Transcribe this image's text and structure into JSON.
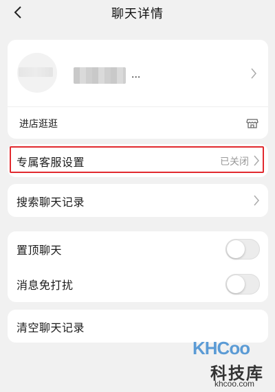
{
  "header": {
    "title": "聊天详情",
    "back_icon": "chevron-left-icon"
  },
  "shop": {
    "name_suffix": "...",
    "visit_label": "进店逛逛",
    "store_icon": "store-icon"
  },
  "exclusive_service": {
    "label": "专属客服设置",
    "value": "已关闭"
  },
  "search_history": {
    "label": "搜索聊天记录"
  },
  "toggles": [
    {
      "label": "置顶聊天",
      "on": false
    },
    {
      "label": "消息免打扰",
      "on": false
    }
  ],
  "clear_history": {
    "label": "清空聊天记录"
  },
  "watermark": {
    "logo": "KHCoo",
    "cn": "科技库",
    "url": "khcoo.com"
  },
  "colors": {
    "highlight": "#e1282d",
    "background": "#f1f1f1",
    "card": "#ffffff"
  }
}
